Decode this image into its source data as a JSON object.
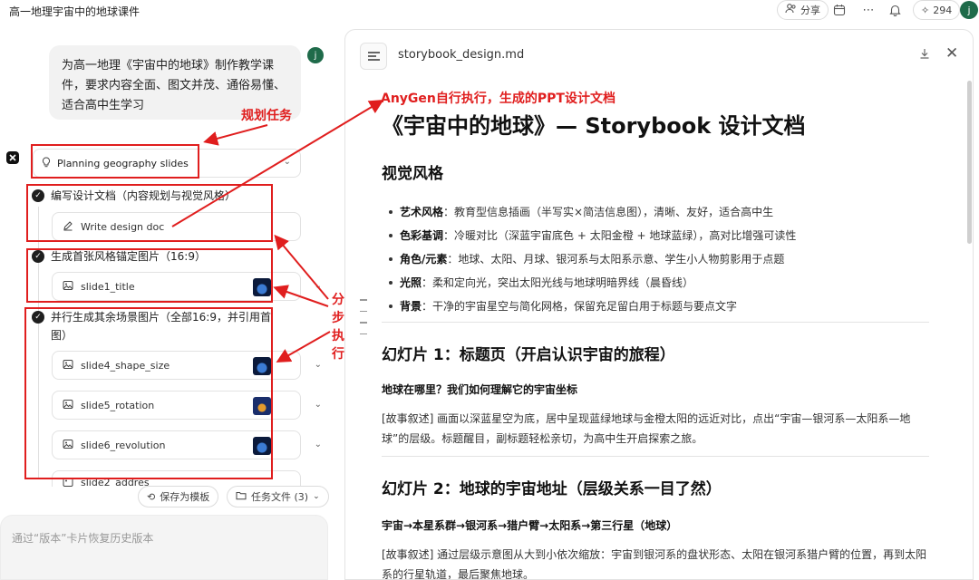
{
  "app": {
    "title": "高一地理宇宙中的地球课件"
  },
  "topbar": {
    "share_label": "分享",
    "credits": "294",
    "user_initial": "j"
  },
  "chat": {
    "user_message": "为高一地理《宇宙中的地球》制作教学课件，要求内容全面、图文并茂、通俗易懂、适合高中生学习",
    "user_initial": "j",
    "plan_label": "Planning geography slides",
    "steps": [
      {
        "title": "编写设计文档（内容规划与视觉风格）",
        "items": [
          "Write design doc"
        ]
      },
      {
        "title": "生成首张风格锚定图片（16:9）",
        "items": [
          "slide1_title"
        ]
      },
      {
        "title": "并行生成其余场景图片（全部16:9，并引用首图）",
        "items": [
          "slide4_shape_size",
          "slide5_rotation",
          "slide6_revolution",
          "slide2_addres"
        ]
      }
    ],
    "save_template_label": "保存为模板",
    "task_files_label": "任务文件 (3)",
    "input_placeholder": "通过“版本”卡片恢复历史版本"
  },
  "annotations": {
    "plan_task": "规划任务",
    "doc_generated": "AnyGen自行执行，生成的PPT设计文档",
    "stepwise": [
      "分",
      "步",
      "执",
      "行"
    ],
    "colors": {
      "red": "#e01e1e"
    }
  },
  "document": {
    "file_name": "storybook_design.md",
    "h1": "《宇宙中的地球》— Storybook 设计文档",
    "visual_style": {
      "heading": "视觉风格",
      "bullets": [
        {
          "label": "艺术风格",
          "text": "：教育型信息插画（半写实×简洁信息图），清晰、友好，适合高中生"
        },
        {
          "label": "色彩基调",
          "text": "：冷暖对比（深蓝宇宙底色 + 太阳金橙 + 地球蓝绿），高对比增强可读性"
        },
        {
          "label": "角色/元素",
          "text": "：地球、太阳、月球、银河系与太阳系示意、学生小人物剪影用于点题"
        },
        {
          "label": "光照",
          "text": "：柔和定向光，突出太阳光线与地球明暗界线（晨昏线）"
        },
        {
          "label": "背景",
          "text": "：干净的宇宙星空与简化网格，保留充足留白用于标题与要点文字"
        }
      ]
    },
    "slide1": {
      "heading": "幻灯片 1：标题页（开启认识宇宙的旅程）",
      "subheading": "地球在哪里？我们如何理解它的宇宙坐标",
      "story": "[故事叙述] 画面以深蓝星空为底，居中呈现蓝绿地球与金橙太阳的远近对比，点出“宇宙—银河系—太阳系—地球”的层级。标题醒目，副标题轻松亲切，为高中生开启探索之旅。"
    },
    "slide2": {
      "heading": "幻灯片 2：地球的宇宙地址（层级关系一目了然）",
      "subheading": "宇宙→本星系群→银河系→猎户臂→太阳系→第三行星（地球）",
      "story": "[故事叙述] 通过层级示意图从大到小依次缩放：宇宙到银河系的盘状形态、太阳在银河系猎户臂的位置，再到太阳系的行星轨道，最后聚焦地球。"
    }
  }
}
